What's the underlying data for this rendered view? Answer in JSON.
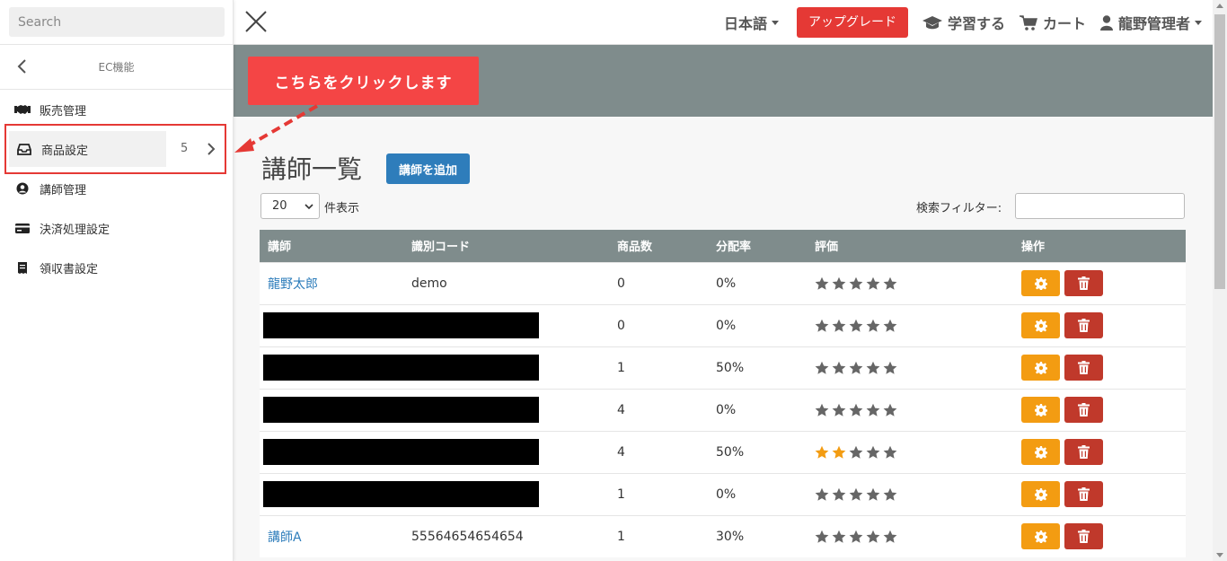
{
  "search": {
    "placeholder": "Search"
  },
  "sidebar": {
    "title": "EC機能",
    "items": [
      {
        "label": "販売管理",
        "icon": "handshake-icon"
      },
      {
        "label": "商品設定",
        "icon": "inbox-icon",
        "count": "5"
      },
      {
        "label": "講師管理",
        "icon": "user-circle-icon"
      },
      {
        "label": "決済処理設定",
        "icon": "credit-card-icon"
      },
      {
        "label": "領収書設定",
        "icon": "receipt-icon"
      }
    ]
  },
  "topbar": {
    "language": "日本語",
    "upgrade": "アップグレード",
    "learn": "学習する",
    "cart": "カート",
    "user": "龍野管理者"
  },
  "callout": {
    "text": "こちらをクリックします"
  },
  "page": {
    "title": "講師一覧",
    "add_button": "講師を追加",
    "length_value": "20",
    "length_label": "件表示",
    "filter_label": "検索フィルター:"
  },
  "table": {
    "headers": [
      "講師",
      "識別コード",
      "商品数",
      "分配率",
      "評価",
      "操作"
    ],
    "rows": [
      {
        "name": "龍野太郎",
        "code": "demo",
        "count": "0",
        "rate": "0%",
        "rating": 0
      },
      {
        "name": "",
        "code": "",
        "count": "0",
        "rate": "0%",
        "rating": 0
      },
      {
        "name": "",
        "code": "",
        "count": "1",
        "rate": "50%",
        "rating": 0
      },
      {
        "name": "",
        "code": "",
        "count": "4",
        "rate": "0%",
        "rating": 0
      },
      {
        "name": "",
        "code": "",
        "count": "4",
        "rate": "50%",
        "rating": 2
      },
      {
        "name": "",
        "code": "",
        "count": "1",
        "rate": "0%",
        "rating": 0
      },
      {
        "name": "講師A",
        "code": "55564654654654",
        "count": "1",
        "rate": "30%",
        "rating": 0
      }
    ]
  },
  "colors": {
    "accent_blue": "#2e7dbb",
    "upgrade_red": "#e53935",
    "header_gray": "#7f8c8c",
    "gear_orange": "#f39c12",
    "trash_red": "#c0392b",
    "star_on": "#f39c12",
    "star_off": "#666666"
  }
}
